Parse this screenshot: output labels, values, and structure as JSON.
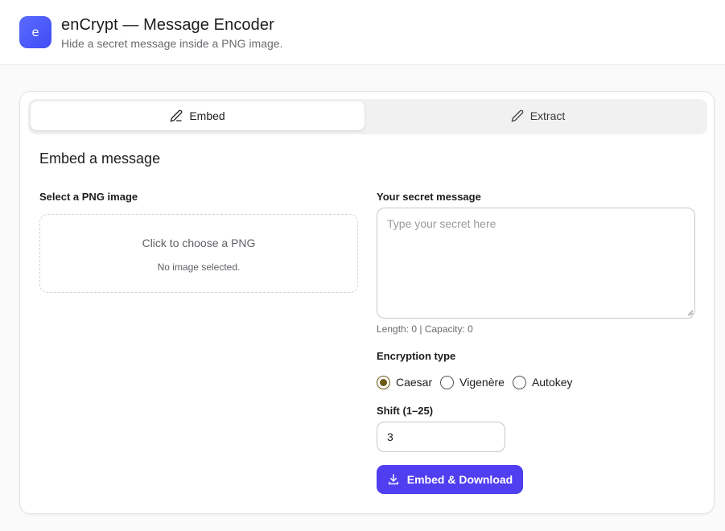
{
  "app": {
    "logo_letter": "e",
    "title": "enCrypt — Message Encoder",
    "subtitle": "Hide a secret message inside a PNG image."
  },
  "tabs": [
    {
      "label": "Embed",
      "icon": "pencil-icon",
      "active": true
    },
    {
      "label": "Extract",
      "icon": "pencil-icon",
      "active": false
    }
  ],
  "embed": {
    "section_title": "Embed a message",
    "image_label": "Select a PNG image",
    "dropzone_text": "Click to choose a PNG",
    "dropzone_status": "No image selected.",
    "message_label": "Your secret message",
    "message_placeholder": "Type your secret here",
    "message_value": "",
    "length_text": "Length: 0 | Capacity: 0",
    "encryption_label": "Encryption type",
    "encryption_options": [
      "Caesar",
      "Vigenère",
      "Autokey"
    ],
    "encryption_selected": "Caesar",
    "shift_label": "Shift (1–25)",
    "shift_value": "3",
    "submit_label": "Embed & Download",
    "submit_icon": "download-icon"
  },
  "colors": {
    "accent": "#4f3ff0",
    "logo": "#4a57f8",
    "radio_checked": "#6b5b12"
  }
}
